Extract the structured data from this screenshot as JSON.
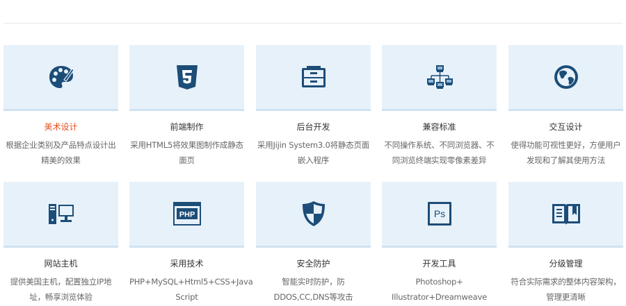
{
  "colors": {
    "icon": "#1c4d78",
    "tile_bg": "#e7f1fa",
    "active_title": "#e8501d",
    "title": "#333333",
    "desc": "#666666"
  },
  "services": [
    {
      "title": "美术设计",
      "desc": "根据企业类别及产品特点设计出精美的效果",
      "icon": "palette-icon",
      "active": true
    },
    {
      "title": "前端制作",
      "desc": "采用HTML5将效果图制作成静态面页",
      "icon": "html5-icon",
      "active": false
    },
    {
      "title": "后台开发",
      "desc": "采用Jijin System3.0将静态页面嵌入程序",
      "icon": "drawer-icon",
      "active": false
    },
    {
      "title": "兼容标准",
      "desc": "不同操作系统、不同浏览器、不同浏览终端实现零像素差异",
      "icon": "network-icon",
      "active": false
    },
    {
      "title": "交互设计",
      "desc": "使得功能可视性更好，方便用户发现和了解其使用方法",
      "icon": "globe-icon",
      "active": false
    },
    {
      "title": "网站主机",
      "desc": "提供美国主机，配置独立IP地址，畅享浏览体验",
      "icon": "computer-icon",
      "active": false
    },
    {
      "title": "采用技术",
      "desc": "PHP+MySQL+Html5+CSS+Java Script",
      "icon": "php-icon",
      "active": false,
      "icon_text": "PHP"
    },
    {
      "title": "安全防护",
      "desc": "智能实时防护，防DDOS,CC,DNS等攻击",
      "icon": "shield-icon",
      "active": false
    },
    {
      "title": "开发工具",
      "desc": "Photoshop+ Illustrator+Dreamweave",
      "icon": "photoshop-icon",
      "active": false,
      "icon_text": "Ps"
    },
    {
      "title": "分级管理",
      "desc": "符合实际需求的整体内容架构，管理更清晰",
      "icon": "book-icon",
      "active": false
    }
  ]
}
